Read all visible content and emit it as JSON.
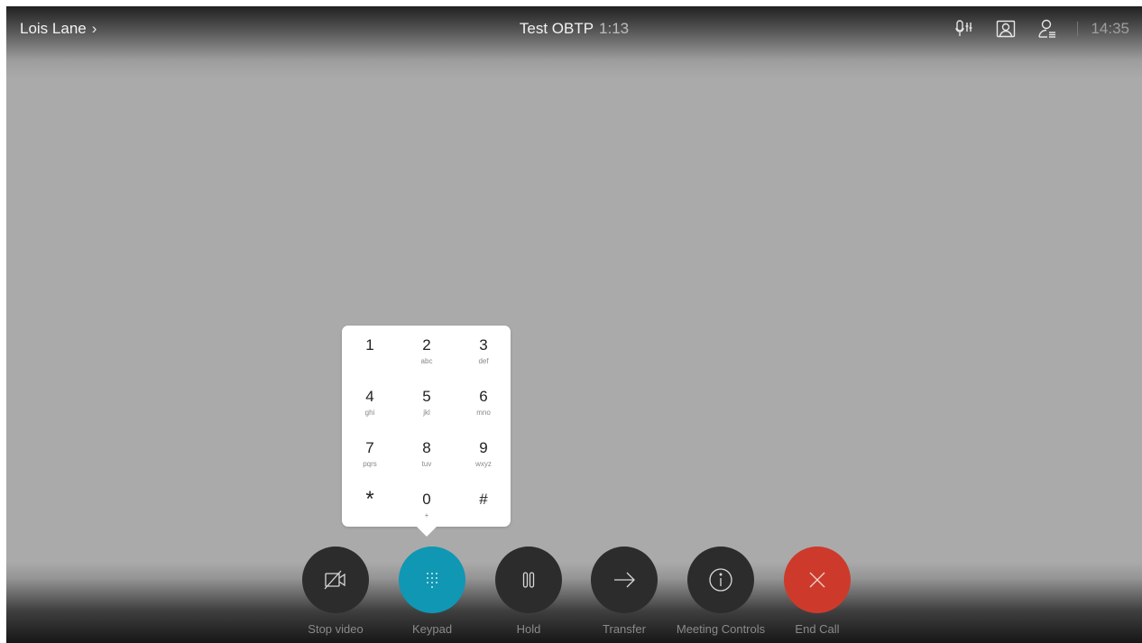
{
  "colors": {
    "background": "#aaaaaa",
    "keypad_active": "#0f97b3",
    "end_call": "#cd3a2c",
    "button_dark": "#2c2c2c"
  },
  "header": {
    "caller_name": "Lois Lane",
    "caller_chevron": "›",
    "call_title": "Test OBTP",
    "call_duration": "1:13",
    "icons": [
      "microphone-settings-icon",
      "self-view-icon",
      "participants-icon"
    ],
    "clock": "14:35"
  },
  "keypad": {
    "keys": [
      {
        "digit": "1",
        "letters": ""
      },
      {
        "digit": "2",
        "letters": "abc"
      },
      {
        "digit": "3",
        "letters": "def"
      },
      {
        "digit": "4",
        "letters": "ghi"
      },
      {
        "digit": "5",
        "letters": "jkl"
      },
      {
        "digit": "6",
        "letters": "mno"
      },
      {
        "digit": "7",
        "letters": "pqrs"
      },
      {
        "digit": "8",
        "letters": "tuv"
      },
      {
        "digit": "9",
        "letters": "wxyz"
      },
      {
        "digit": "*",
        "letters": ""
      },
      {
        "digit": "0",
        "letters": "+"
      },
      {
        "digit": "#",
        "letters": ""
      }
    ]
  },
  "controls": [
    {
      "label": "Stop video",
      "icon": "video-off-icon"
    },
    {
      "label": "Keypad",
      "icon": "keypad-icon"
    },
    {
      "label": "Hold",
      "icon": "pause-icon"
    },
    {
      "label": "Transfer",
      "icon": "arrow-right-icon"
    },
    {
      "label": "Meeting Controls",
      "icon": "info-icon"
    },
    {
      "label": "End Call",
      "icon": "close-icon"
    }
  ]
}
